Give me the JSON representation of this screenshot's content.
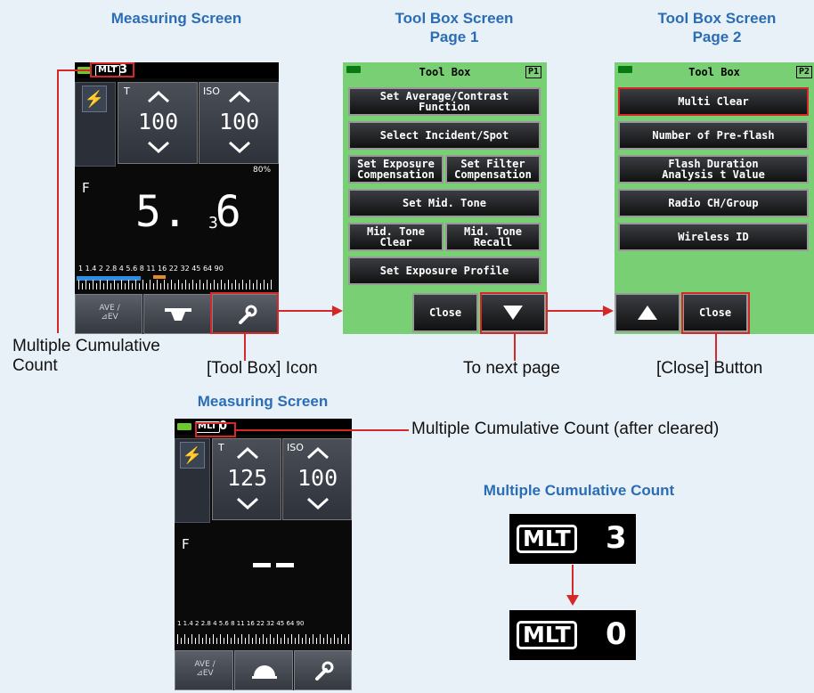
{
  "titles": {
    "measuring_1": "Measuring Screen",
    "toolbox_p1": "Tool Box Screen\nPage 1",
    "toolbox_p2": "Tool Box Screen\nPage 2",
    "measuring_2": "Measuring Screen",
    "mlt_zoom": "Multiple Cumulative Count"
  },
  "callouts": {
    "multiple_count": "Multiple Cumulative\nCount",
    "toolbox_icon": "[Tool Box] Icon",
    "next_page": "To next page",
    "close_button": "[Close] Button",
    "count_after_cleared": "Multiple Cumulative Count (after cleared)"
  },
  "measuring_1": {
    "mlt_badge": "MLT",
    "mlt_count": "3",
    "t_label": "T",
    "t_value": "100",
    "iso_label": "ISO",
    "iso_value": "100",
    "percent": "80%",
    "f_label": "F",
    "f_value": "5. 6",
    "f_sub": "3",
    "scale": "1  1.4  2  2.8  4  5.6  8  11  16  22  32  45  64  90",
    "ave_label": "AVE /\n⊿EV"
  },
  "toolbox_p1": {
    "title": "Tool Box",
    "page": "P1",
    "buttons": [
      "Set Average/Contrast\nFunction",
      "Select Incident/Spot",
      "Set Exposure\nCompensation",
      "Set Filter\nCompensation",
      "Set Mid. Tone",
      "Mid. Tone\nClear",
      "Mid. Tone\nRecall",
      "Set Exposure Profile"
    ],
    "close": "Close"
  },
  "toolbox_p2": {
    "title": "Tool Box",
    "page": "P2",
    "buttons": [
      "Multi Clear",
      "Number of Pre-flash",
      "Flash Duration\nAnalysis t Value",
      "Radio CH/Group",
      "Wireless ID"
    ],
    "close": "Close"
  },
  "measuring_2": {
    "mlt_badge": "MLT",
    "mlt_count": "0",
    "t_label": "T",
    "t_value": "125",
    "iso_label": "ISO",
    "iso_value": "100",
    "f_label": "F",
    "scale": "1  1.4  2  2.8  4  5.6  8  11  16  22  32  45  64  90",
    "ave_label": "AVE /\n⊿EV"
  },
  "zoom": {
    "badge": "MLT",
    "before": "3",
    "after": "0"
  },
  "colors": {
    "accent_title": "#2a6db5",
    "highlight_red": "#d62828",
    "toolbox_green": "#79cf73",
    "battery_green": "#6cc82c",
    "flash_blue": "#3fa9ff"
  }
}
